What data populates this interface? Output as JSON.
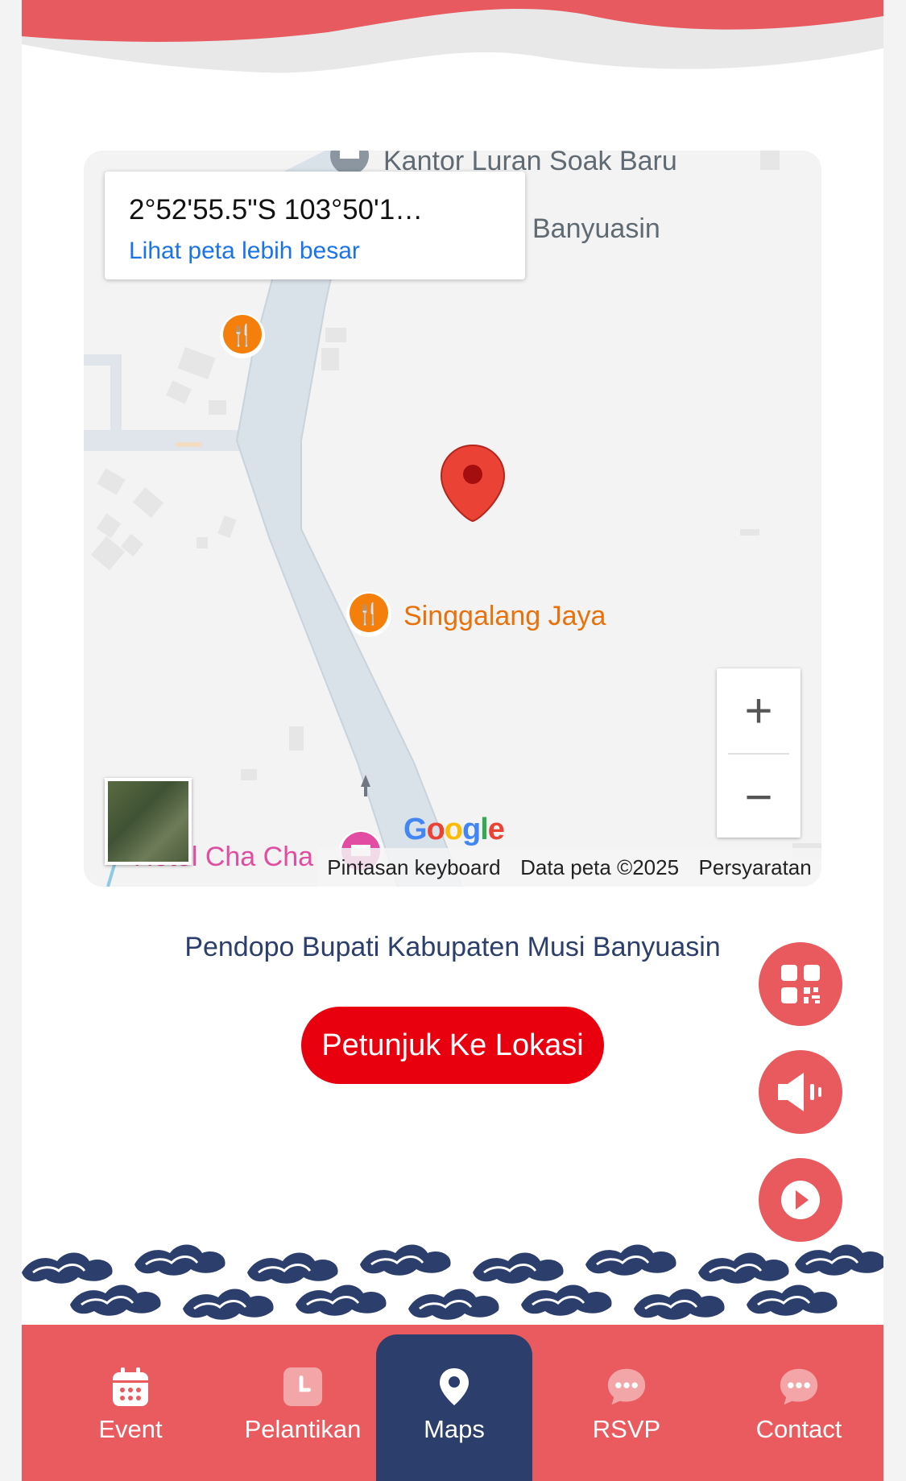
{
  "map": {
    "coords": "2°52'55.5\"S 103°50'1…",
    "bigger_map_link": "Lihat peta lebih besar",
    "labels": {
      "kantor": "Kantor Luran Soak Baru",
      "banyuasin": "i Banyuasin",
      "singgalang": "Singgalang Jaya",
      "hotel": "Hotel Cha Cha"
    },
    "zoom_in": "+",
    "zoom_out": "−",
    "google_logo": "Google",
    "attribution": {
      "shortcuts": "Pintasan keyboard",
      "data": "Data peta ©2025",
      "terms": "Persyaratan"
    }
  },
  "venue_name": "Pendopo Bupati Kabupaten Musi Banyuasin",
  "direction_button": "Petunjuk Ke Lokasi",
  "floating_buttons": {
    "qr": "qr-code-icon",
    "sound": "speaker-icon",
    "play": "play-icon"
  },
  "bottom_nav": [
    {
      "label": "Event",
      "icon": "calendar-icon"
    },
    {
      "label": "Pelantikan",
      "icon": "clock-icon"
    },
    {
      "label": "Maps",
      "icon": "location-pin-icon",
      "active": true
    },
    {
      "label": "RSVP",
      "icon": "chat-bubble-icon"
    },
    {
      "label": "Contact",
      "icon": "chat-bubble-icon"
    }
  ],
  "colors": {
    "accent_red": "#e8000f",
    "coral": "#ea5b5f",
    "navy": "#2c3e6b"
  }
}
